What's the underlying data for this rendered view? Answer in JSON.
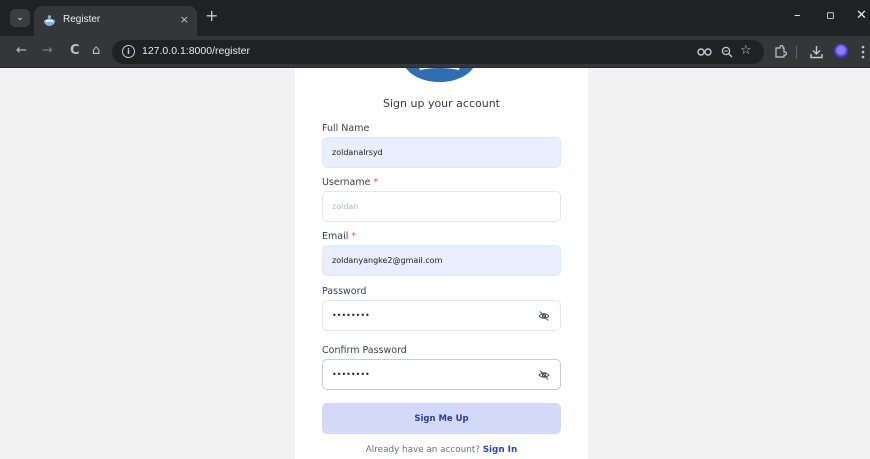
{
  "browser": {
    "tab_title": "Register",
    "tab_close": "×",
    "new_tab": "+",
    "url": "127.0.0.1:8000/register",
    "window_controls": {
      "minimize": "–",
      "restore": "▫",
      "close": "✕"
    },
    "nav": {
      "back": "←",
      "forward": "→",
      "reload": "C",
      "home": "⌂"
    },
    "toolbar_icons": [
      "password-key-icon",
      "zoom-icon",
      "bookmark-star-icon",
      "extensions-icon",
      "download-icon",
      "profile-avatar",
      "menu-kebab-icon"
    ],
    "colors": {
      "tabstrip": "#202124",
      "toolbar": "#35363a",
      "omnibox": "#202124"
    }
  },
  "form": {
    "heading": "Sign up your account",
    "full_name": {
      "label": "Full Name",
      "value": "zoldanalrsyd"
    },
    "username": {
      "label": "Username",
      "required_mark": "*",
      "placeholder": "zoldan",
      "value": ""
    },
    "email": {
      "label": "Email",
      "required_mark": "*",
      "value": "zoldanyangke2@gmail.com"
    },
    "password": {
      "label": "Password",
      "value": "••••••••"
    },
    "confirm_password": {
      "label": "Confirm Password",
      "value": "••••••••"
    },
    "submit_label": "Sign Me Up",
    "signin_prompt": "Already have an account?",
    "signin_link": "Sign In",
    "colors": {
      "filled_bg": "#e8eefb",
      "button_bg": "#d2daf8",
      "button_text": "#2e3d8c",
      "link": "#2f46b2",
      "required": "#e05252"
    }
  }
}
